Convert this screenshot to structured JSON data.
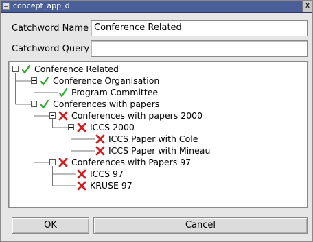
{
  "window": {
    "title": "concept_app_d",
    "close_glyph": "X"
  },
  "form": {
    "name_label": "Catchword Name",
    "name_value": "Conference Related",
    "query_label": "Catchword Query",
    "query_value": ""
  },
  "tree": {
    "colors": {
      "check": "#2fa52f",
      "cross": "#cc1f1f",
      "line": "#777777"
    },
    "nodes": [
      {
        "label": "Conference Related",
        "status": "check",
        "depth": 0,
        "expanded": true
      },
      {
        "label": "Conference Organisation",
        "status": "check",
        "depth": 1,
        "expanded": true
      },
      {
        "label": "Program Committee",
        "status": "check",
        "depth": 2,
        "expanded": false
      },
      {
        "label": "Conferences with papers",
        "status": "check",
        "depth": 1,
        "expanded": true
      },
      {
        "label": "Conferences with papers 2000",
        "status": "cross",
        "depth": 2,
        "expanded": true
      },
      {
        "label": "ICCS 2000",
        "status": "cross",
        "depth": 3,
        "expanded": true
      },
      {
        "label": "ICCS Paper with Cole",
        "status": "cross",
        "depth": 4,
        "expanded": false
      },
      {
        "label": "ICCS Paper with Mineau",
        "status": "cross",
        "depth": 4,
        "expanded": false
      },
      {
        "label": "Conferences with Papers 97",
        "status": "cross",
        "depth": 2,
        "expanded": true
      },
      {
        "label": "ICCS 97",
        "status": "cross",
        "depth": 3,
        "expanded": false
      },
      {
        "label": "KRUSE 97",
        "status": "cross",
        "depth": 3,
        "expanded": false
      }
    ]
  },
  "buttons": {
    "ok": "OK",
    "cancel": "Cancel"
  }
}
